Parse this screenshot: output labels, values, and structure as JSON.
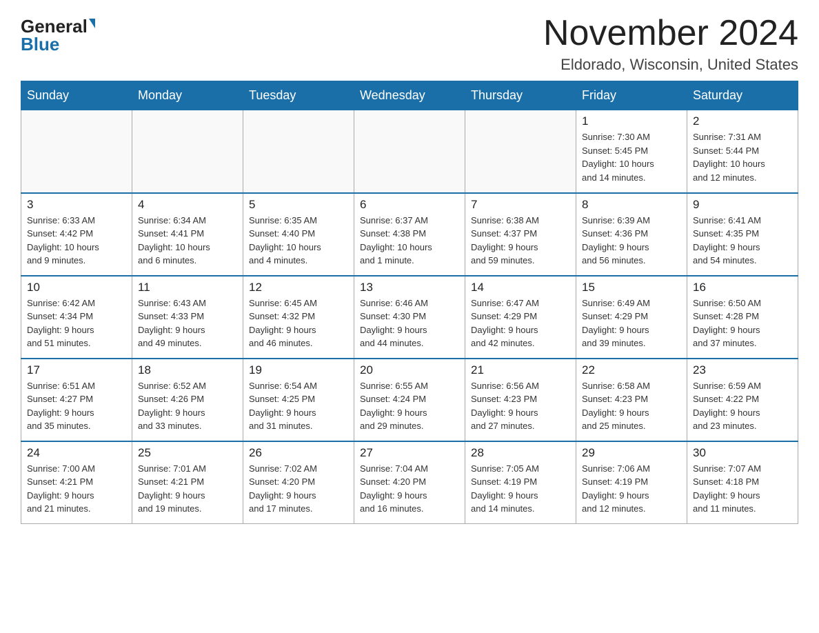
{
  "header": {
    "logo_general": "General",
    "logo_blue": "Blue",
    "month": "November 2024",
    "location": "Eldorado, Wisconsin, United States"
  },
  "weekdays": [
    "Sunday",
    "Monday",
    "Tuesday",
    "Wednesday",
    "Thursday",
    "Friday",
    "Saturday"
  ],
  "weeks": [
    [
      {
        "day": "",
        "info": ""
      },
      {
        "day": "",
        "info": ""
      },
      {
        "day": "",
        "info": ""
      },
      {
        "day": "",
        "info": ""
      },
      {
        "day": "",
        "info": ""
      },
      {
        "day": "1",
        "info": "Sunrise: 7:30 AM\nSunset: 5:45 PM\nDaylight: 10 hours\nand 14 minutes."
      },
      {
        "day": "2",
        "info": "Sunrise: 7:31 AM\nSunset: 5:44 PM\nDaylight: 10 hours\nand 12 minutes."
      }
    ],
    [
      {
        "day": "3",
        "info": "Sunrise: 6:33 AM\nSunset: 4:42 PM\nDaylight: 10 hours\nand 9 minutes."
      },
      {
        "day": "4",
        "info": "Sunrise: 6:34 AM\nSunset: 4:41 PM\nDaylight: 10 hours\nand 6 minutes."
      },
      {
        "day": "5",
        "info": "Sunrise: 6:35 AM\nSunset: 4:40 PM\nDaylight: 10 hours\nand 4 minutes."
      },
      {
        "day": "6",
        "info": "Sunrise: 6:37 AM\nSunset: 4:38 PM\nDaylight: 10 hours\nand 1 minute."
      },
      {
        "day": "7",
        "info": "Sunrise: 6:38 AM\nSunset: 4:37 PM\nDaylight: 9 hours\nand 59 minutes."
      },
      {
        "day": "8",
        "info": "Sunrise: 6:39 AM\nSunset: 4:36 PM\nDaylight: 9 hours\nand 56 minutes."
      },
      {
        "day": "9",
        "info": "Sunrise: 6:41 AM\nSunset: 4:35 PM\nDaylight: 9 hours\nand 54 minutes."
      }
    ],
    [
      {
        "day": "10",
        "info": "Sunrise: 6:42 AM\nSunset: 4:34 PM\nDaylight: 9 hours\nand 51 minutes."
      },
      {
        "day": "11",
        "info": "Sunrise: 6:43 AM\nSunset: 4:33 PM\nDaylight: 9 hours\nand 49 minutes."
      },
      {
        "day": "12",
        "info": "Sunrise: 6:45 AM\nSunset: 4:32 PM\nDaylight: 9 hours\nand 46 minutes."
      },
      {
        "day": "13",
        "info": "Sunrise: 6:46 AM\nSunset: 4:30 PM\nDaylight: 9 hours\nand 44 minutes."
      },
      {
        "day": "14",
        "info": "Sunrise: 6:47 AM\nSunset: 4:29 PM\nDaylight: 9 hours\nand 42 minutes."
      },
      {
        "day": "15",
        "info": "Sunrise: 6:49 AM\nSunset: 4:29 PM\nDaylight: 9 hours\nand 39 minutes."
      },
      {
        "day": "16",
        "info": "Sunrise: 6:50 AM\nSunset: 4:28 PM\nDaylight: 9 hours\nand 37 minutes."
      }
    ],
    [
      {
        "day": "17",
        "info": "Sunrise: 6:51 AM\nSunset: 4:27 PM\nDaylight: 9 hours\nand 35 minutes."
      },
      {
        "day": "18",
        "info": "Sunrise: 6:52 AM\nSunset: 4:26 PM\nDaylight: 9 hours\nand 33 minutes."
      },
      {
        "day": "19",
        "info": "Sunrise: 6:54 AM\nSunset: 4:25 PM\nDaylight: 9 hours\nand 31 minutes."
      },
      {
        "day": "20",
        "info": "Sunrise: 6:55 AM\nSunset: 4:24 PM\nDaylight: 9 hours\nand 29 minutes."
      },
      {
        "day": "21",
        "info": "Sunrise: 6:56 AM\nSunset: 4:23 PM\nDaylight: 9 hours\nand 27 minutes."
      },
      {
        "day": "22",
        "info": "Sunrise: 6:58 AM\nSunset: 4:23 PM\nDaylight: 9 hours\nand 25 minutes."
      },
      {
        "day": "23",
        "info": "Sunrise: 6:59 AM\nSunset: 4:22 PM\nDaylight: 9 hours\nand 23 minutes."
      }
    ],
    [
      {
        "day": "24",
        "info": "Sunrise: 7:00 AM\nSunset: 4:21 PM\nDaylight: 9 hours\nand 21 minutes."
      },
      {
        "day": "25",
        "info": "Sunrise: 7:01 AM\nSunset: 4:21 PM\nDaylight: 9 hours\nand 19 minutes."
      },
      {
        "day": "26",
        "info": "Sunrise: 7:02 AM\nSunset: 4:20 PM\nDaylight: 9 hours\nand 17 minutes."
      },
      {
        "day": "27",
        "info": "Sunrise: 7:04 AM\nSunset: 4:20 PM\nDaylight: 9 hours\nand 16 minutes."
      },
      {
        "day": "28",
        "info": "Sunrise: 7:05 AM\nSunset: 4:19 PM\nDaylight: 9 hours\nand 14 minutes."
      },
      {
        "day": "29",
        "info": "Sunrise: 7:06 AM\nSunset: 4:19 PM\nDaylight: 9 hours\nand 12 minutes."
      },
      {
        "day": "30",
        "info": "Sunrise: 7:07 AM\nSunset: 4:18 PM\nDaylight: 9 hours\nand 11 minutes."
      }
    ]
  ]
}
